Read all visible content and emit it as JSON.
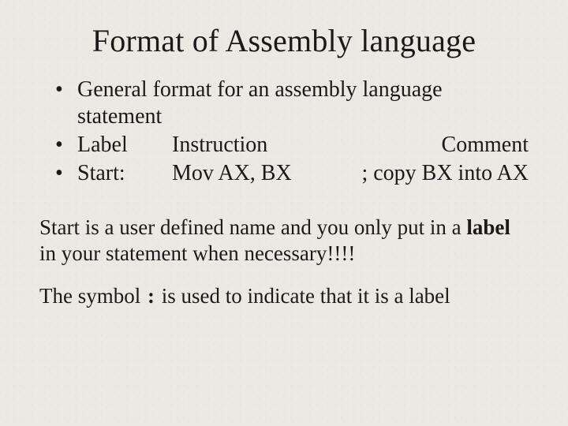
{
  "title": "Format of Assembly language",
  "bullets": {
    "b1": "General format for an assembly language statement",
    "b2": {
      "label": "Label",
      "instruction": "Instruction",
      "comment": "Comment"
    },
    "b3": {
      "label": "Start:",
      "instruction": "Mov  AX, BX",
      "comment": "; copy BX into AX"
    }
  },
  "para1": {
    "pre": "Start is a user defined name and you only put in a ",
    "bold": "label",
    "post": " in your statement when necessary!!!!"
  },
  "para2": {
    "pre": "The symbol ",
    "symbol": ":",
    "post": " is used to indicate that it is a label"
  }
}
